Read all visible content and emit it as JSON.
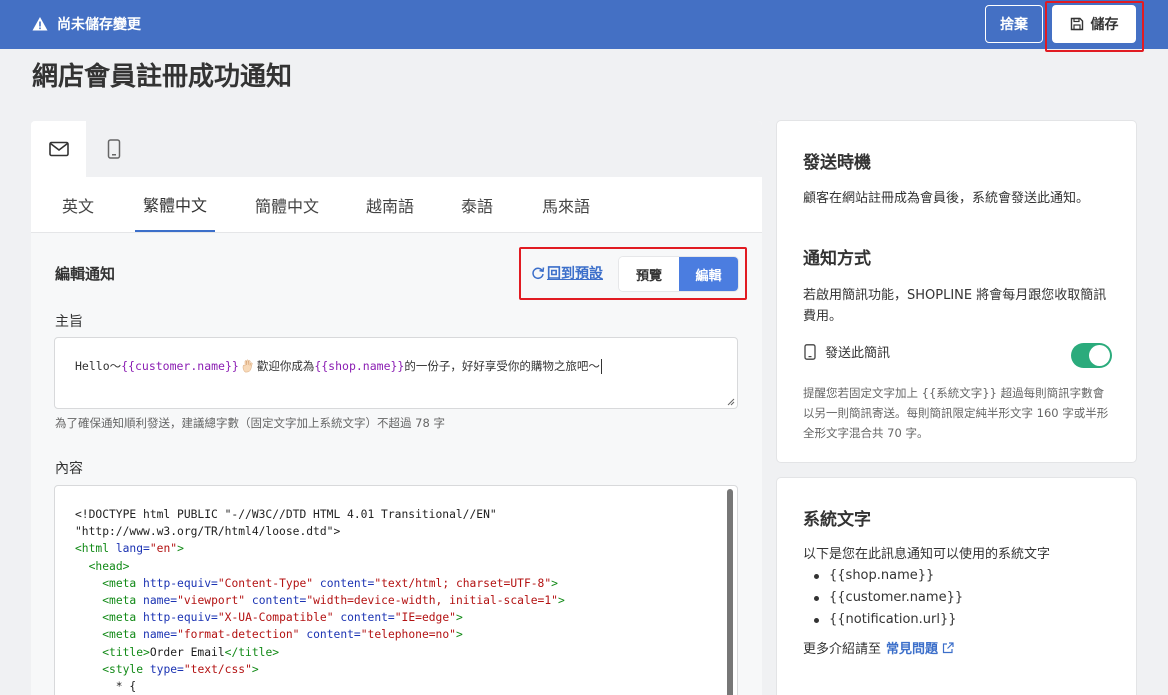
{
  "topbar": {
    "unsaved_label": "尚未儲存變更",
    "discard_label": "捨棄",
    "save_label": "儲存",
    "background_color": "#4470c4"
  },
  "page": {
    "title": "網店會員註冊成功通知"
  },
  "channels": [
    {
      "name": "email",
      "icon": "mail-icon",
      "active": true
    },
    {
      "name": "sms",
      "icon": "phone-icon",
      "active": false
    }
  ],
  "language_tabs": [
    {
      "label": "英文",
      "active": false
    },
    {
      "label": "繁體中文",
      "active": true
    },
    {
      "label": "簡體中文",
      "active": false
    },
    {
      "label": "越南語",
      "active": false
    },
    {
      "label": "泰語",
      "active": false
    },
    {
      "label": "馬來語",
      "active": false
    }
  ],
  "editor": {
    "heading": "編輯通知",
    "reset_label": "回到預設",
    "preview_label": "預覽",
    "edit_label": "編輯",
    "subject_label": "主旨",
    "subject": {
      "prefix": "Hello～",
      "var1": "{{customer.name}}",
      "middle": "歡迎你成為 ",
      "var2": "{{shop.name}}",
      "suffix": " 的一份子，好好享受你的購物之旅吧～"
    },
    "subject_hint": "為了確保通知順利發送，建議總字數（固定文字加上系統文字）不超過 78 字",
    "content_label": "內容",
    "content_lines": [
      "<!DOCTYPE html PUBLIC \"-//W3C//DTD HTML 4.01 Transitional//EN\"",
      "\"http://www.w3.org/TR/html4/loose.dtd\">",
      "<html lang=\"en\">",
      "  <head>",
      "    <meta http-equiv=\"Content-Type\" content=\"text/html; charset=UTF-8\">",
      "    <meta name=\"viewport\" content=\"width=device-width, initial-scale=1\">",
      "    <meta http-equiv=\"X-UA-Compatible\" content=\"IE=edge\">",
      "    <meta name=\"format-detection\" content=\"telephone=no\">",
      "    <title>Order Email</title>",
      "    <style type=\"text/css\">",
      "      * {"
    ]
  },
  "send_timing": {
    "title": "發送時機",
    "text": "顧客在網站註冊成為會員後，系統會發送此通知。"
  },
  "notify_method": {
    "title": "通知方式",
    "text": "若啟用簡訊功能，SHOPLINE 將會每月跟您收取簡訊費用。",
    "sms_label": "發送此簡訊",
    "sms_enabled": true,
    "toggle_color": "#2bab7c",
    "note": "提醒您若固定文字加上 {{系統文字}} 超過每則簡訊字數會以另一則簡訊寄送。每則簡訊限定純半形文字 160 字或半形全形文字混合共 70 字。"
  },
  "system_text": {
    "title": "系統文字",
    "intro": "以下是您在此訊息通知可以使用的系統文字",
    "items": [
      "{{shop.name}}",
      "{{customer.name}}",
      "{{notification.url}}"
    ],
    "more_prefix": "更多介紹請至",
    "faq_label": "常見問題"
  }
}
